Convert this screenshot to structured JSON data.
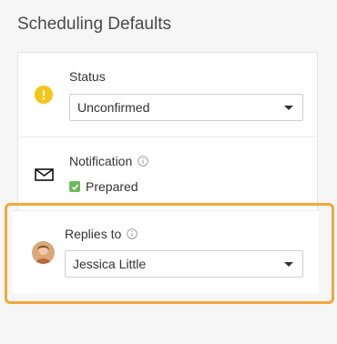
{
  "page": {
    "title": "Scheduling Defaults"
  },
  "status": {
    "label": "Status",
    "value": "Unconfirmed",
    "icon": "alert-circle-icon",
    "icon_color": "#f5c518"
  },
  "notification": {
    "label": "Notification",
    "info_icon": "info-icon",
    "icon": "envelope-icon",
    "checkbox_label": "Prepared",
    "checked": true,
    "check_color": "#6dbb5a"
  },
  "replies_to": {
    "label": "Replies to",
    "info_icon": "info-icon",
    "value": "Jessica Little"
  },
  "colors": {
    "highlight": "#f3a73a",
    "background": "#f6f6f6"
  }
}
